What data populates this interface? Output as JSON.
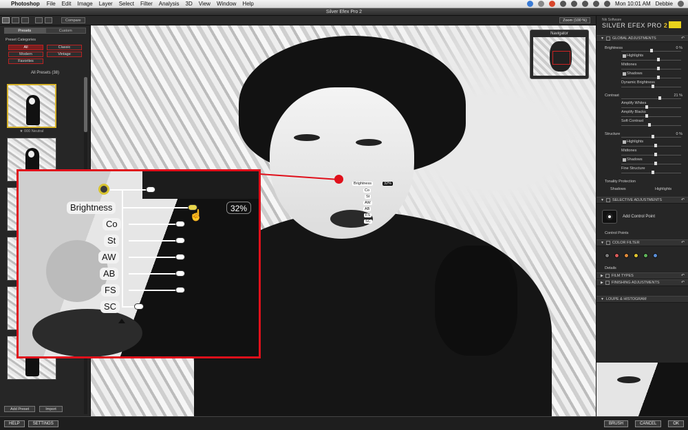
{
  "menubar": {
    "app": "Photoshop",
    "items": [
      "File",
      "Edit",
      "Image",
      "Layer",
      "Select",
      "Filter",
      "Analysis",
      "3D",
      "View",
      "Window",
      "Help"
    ],
    "clock": "Mon 10:01 AM",
    "user": "Debbie"
  },
  "window": {
    "title": "Silver Efex Pro 2"
  },
  "toolbar": {
    "compare_label": "Compare",
    "zoom_label": "Zoom (100 %)"
  },
  "left_panel": {
    "tabs": [
      "Presets",
      "Custom"
    ],
    "categories_header": "Preset Categories",
    "categories": [
      "All",
      "Classic",
      "Modern",
      "Vintage",
      "Favorites"
    ],
    "all_presets_label": "All Presets (38)",
    "first_preset_caption": "★ 000 Neutral",
    "add_preset_label": "Add Preset",
    "import_label": "Import"
  },
  "navigator": {
    "title": "Navigator"
  },
  "control_point": {
    "labels": [
      "Brightness",
      "Co",
      "St",
      "AW",
      "AB",
      "FS",
      "SC"
    ],
    "value": "32%"
  },
  "right_panel": {
    "brand_small": "Nik Software",
    "brand_name": "SILVER EFEX PRO",
    "brand_version": "2",
    "global_header": "GLOBAL ADJUSTMENTS",
    "brightness": {
      "label": "Brightness",
      "value": "0",
      "unit": "%"
    },
    "brightness_subs": [
      "Highlights",
      "Midtones",
      "Shadows",
      "Dynamic Brightness"
    ],
    "contrast": {
      "label": "Contrast",
      "value": "21",
      "unit": "%"
    },
    "contrast_subs": [
      "Amplify Whites",
      "Amplify Blacks",
      "Soft Contrast"
    ],
    "structure": {
      "label": "Structure",
      "value": "0",
      "unit": "%"
    },
    "structure_subs": [
      "Highlights",
      "Midtones",
      "Shadows",
      "Fine Structure"
    ],
    "tonality": {
      "label": "Tonality Protection",
      "shadows": "Shadows",
      "highlights": "Highlights"
    },
    "selective_header": "SELECTIVE ADJUSTMENTS",
    "add_control_point": "Add Control Point",
    "control_points_label": "Control Points",
    "color_filter_header": "COLOR FILTER",
    "filter_colors": [
      "#7a7a7a",
      "#d95a5a",
      "#e08a3a",
      "#e0c530",
      "#5fb45a",
      "#5a8fd9"
    ],
    "details_label": "Details",
    "film_types_header": "FILM TYPES",
    "finishing_header": "FINISHING ADJUSTMENTS",
    "loupe_header": "LOUPE & HISTOGRAM"
  },
  "bottom": {
    "help": "HELP",
    "settings": "SETTINGS",
    "brush": "BRUSH",
    "cancel": "CANCEL",
    "ok": "OK"
  }
}
